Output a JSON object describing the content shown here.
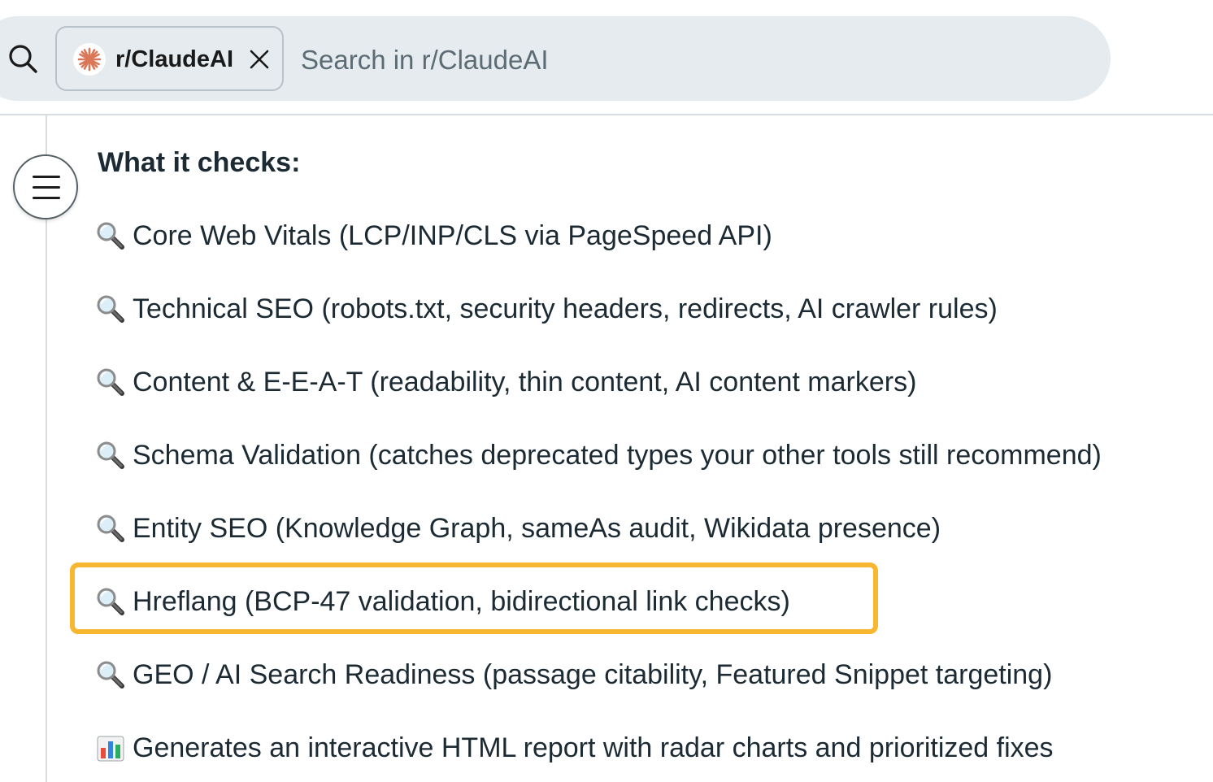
{
  "search": {
    "community_chip": "r/ClaudeAI",
    "placeholder": "Search in r/ClaudeAI",
    "icons": {
      "search": "search-icon",
      "chip_avatar": "claude-logo-icon",
      "chip_remove": "close-icon"
    }
  },
  "comment": {
    "heading": "What it checks:",
    "items": [
      {
        "icon": "magnifying-glass-emoji",
        "text": "Core Web Vitals (LCP/INP/CLS via PageSpeed API)"
      },
      {
        "icon": "magnifying-glass-emoji",
        "text": "Technical SEO (robots.txt, security headers, redirects, AI crawler rules)"
      },
      {
        "icon": "magnifying-glass-emoji",
        "text": "Content & E-E-A-T (readability, thin content, AI content markers)"
      },
      {
        "icon": "magnifying-glass-emoji",
        "text": "Schema Validation (catches deprecated types your other tools still recommend)"
      },
      {
        "icon": "magnifying-glass-emoji",
        "text": "Entity SEO (Knowledge Graph, sameAs audit, Wikidata presence)"
      },
      {
        "icon": "magnifying-glass-emoji",
        "text": "Hreflang (BCP-47 validation, bidirectional link checks)"
      },
      {
        "icon": "magnifying-glass-emoji",
        "text": "GEO / AI Search Readiness (passage citability, Featured Snippet targeting)"
      },
      {
        "icon": "bar-chart-emoji",
        "text": "Generates an interactive HTML report with radar charts and prioritized fixes"
      }
    ]
  },
  "colors": {
    "search_bg": "#e5ebee",
    "highlight": "#f7b731",
    "claude_brand": "#d97757",
    "text": "#1c2b33"
  }
}
